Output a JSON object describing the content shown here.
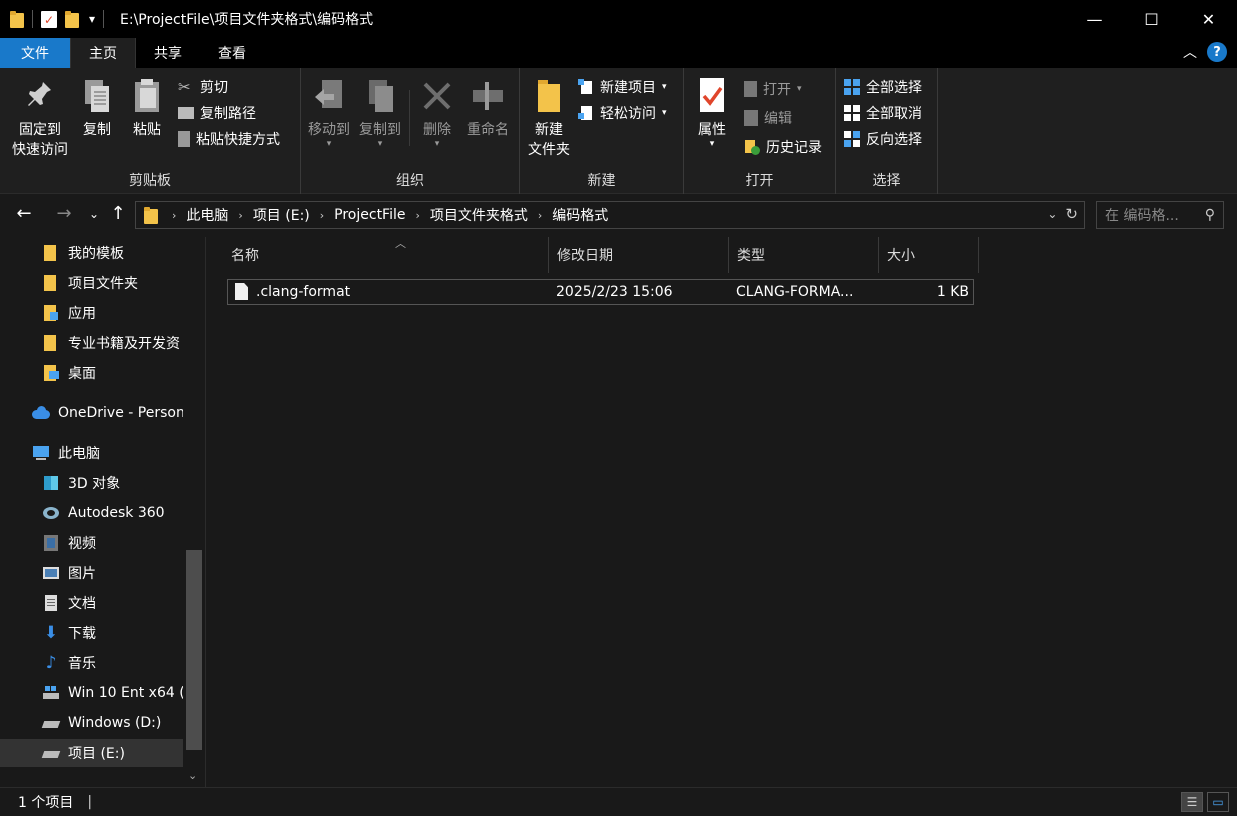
{
  "window": {
    "title": "E:\\ProjectFile\\项目文件夹格式\\编码格式",
    "minimize": "—",
    "maximize": "☐",
    "close": "✕",
    "qa_dropdown": "▾"
  },
  "tabs": [
    {
      "label": "文件"
    },
    {
      "label": "主页"
    },
    {
      "label": "共享"
    },
    {
      "label": "查看"
    }
  ],
  "ribbon": {
    "clipboard": {
      "label": "剪贴板",
      "pin": "固定到\n快速访问",
      "copy": "复制",
      "paste": "粘贴",
      "cut": "剪切",
      "copy_path": "复制路径",
      "paste_shortcut": "粘贴快捷方式"
    },
    "organize": {
      "label": "组织",
      "move_to": "移动到",
      "copy_to": "复制到",
      "delete": "删除",
      "rename": "重命名"
    },
    "new": {
      "label": "新建",
      "new_folder": "新建\n文件夹",
      "new_item": "新建项目",
      "easy_access": "轻松访问"
    },
    "open": {
      "label": "打开",
      "properties": "属性",
      "open": "打开",
      "edit": "编辑",
      "history": "历史记录"
    },
    "select": {
      "label": "选择",
      "select_all": "全部选择",
      "select_none": "全部取消",
      "invert": "反向选择"
    }
  },
  "address": {
    "crumbs": [
      "此电脑",
      "项目 (E:)",
      "ProjectFile",
      "项目文件夹格式",
      "编码格式"
    ],
    "search_placeholder": "在 编码格..."
  },
  "sidebar": {
    "items": [
      {
        "label": "我的模板"
      },
      {
        "label": "项目文件夹"
      },
      {
        "label": "应用"
      },
      {
        "label": "专业书籍及开发资"
      },
      {
        "label": "桌面"
      },
      {
        "label": "OneDrive - Person"
      },
      {
        "label": "此电脑"
      },
      {
        "label": "3D 对象"
      },
      {
        "label": "Autodesk 360"
      },
      {
        "label": "视频"
      },
      {
        "label": "图片"
      },
      {
        "label": "文档"
      },
      {
        "label": "下载"
      },
      {
        "label": "音乐"
      },
      {
        "label": "Win 10 Ent x64 ("
      },
      {
        "label": "Windows (D:)"
      },
      {
        "label": "项目 (E:)"
      }
    ]
  },
  "columns": {
    "name": "名称",
    "modified": "修改日期",
    "type": "类型",
    "size": "大小"
  },
  "files": [
    {
      "name": ".clang-format",
      "modified": "2025/2/23 15:06",
      "type": "CLANG-FORMA...",
      "size": "1 KB"
    }
  ],
  "status": {
    "count": "1 个项目"
  },
  "colors": {
    "accent": "#1979ca",
    "folder": "#f3c34a",
    "background": "#191919"
  }
}
